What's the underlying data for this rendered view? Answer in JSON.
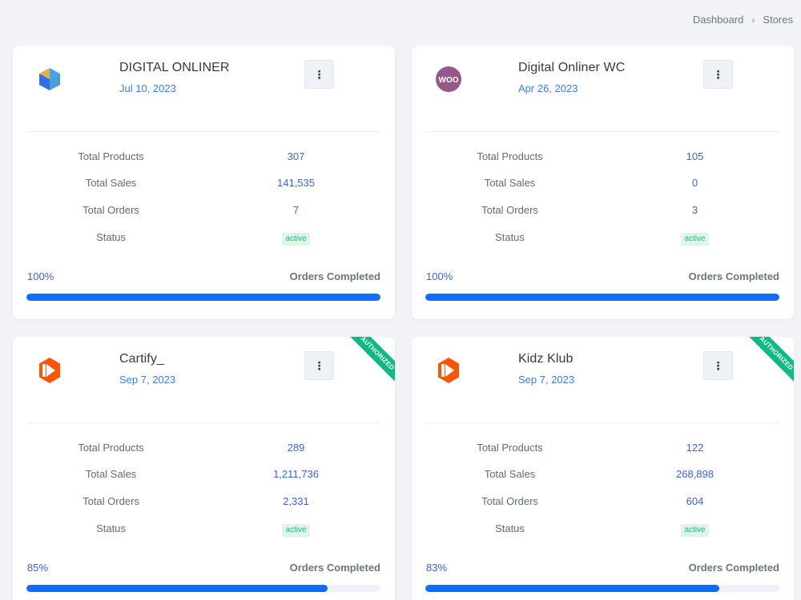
{
  "breadcrumb": {
    "home": "Dashboard",
    "separator": "›",
    "current": "Stores"
  },
  "colors": {
    "accent": "#0d6efd",
    "badge_bg": "#dff5ea",
    "badge_text": "#1abc7b",
    "ribbon": "#10b981"
  },
  "stats_labels": {
    "products": "Total Products",
    "sales": "Total Sales",
    "orders": "Total Orders",
    "status": "Status"
  },
  "orders_completed_label": "Orders Completed",
  "menu_icon": "⋮",
  "stores": [
    {
      "name": "DIGITAL ONLINER",
      "date": "Jul 10, 2023",
      "logo": "cube-logo-icon",
      "products": "307",
      "sales": "141,535",
      "orders": "7",
      "status": "active",
      "progress": 100,
      "progress_text": "100%",
      "ribbon": ""
    },
    {
      "name": "Digital Onliner WC",
      "date": "Apr 26, 2023",
      "logo": "woocommerce-logo-icon",
      "products": "105",
      "sales": "0",
      "orders": "3",
      "status": "active",
      "progress": 100,
      "progress_text": "100%",
      "ribbon": ""
    },
    {
      "name": "Cartify_",
      "date": "Sep 7, 2023",
      "logo": "daraz-logo-icon",
      "products": "289",
      "sales": "1,211,736",
      "orders": "2,331",
      "status": "active",
      "progress": 85,
      "progress_text": "85%",
      "ribbon": "AUTHORIZED"
    },
    {
      "name": "Kidz Klub",
      "date": "Sep 7, 2023",
      "logo": "daraz-logo-icon",
      "products": "122",
      "sales": "268,898",
      "orders": "604",
      "status": "active",
      "progress": 83,
      "progress_text": "83%",
      "ribbon": "AUTHORIZED"
    }
  ]
}
